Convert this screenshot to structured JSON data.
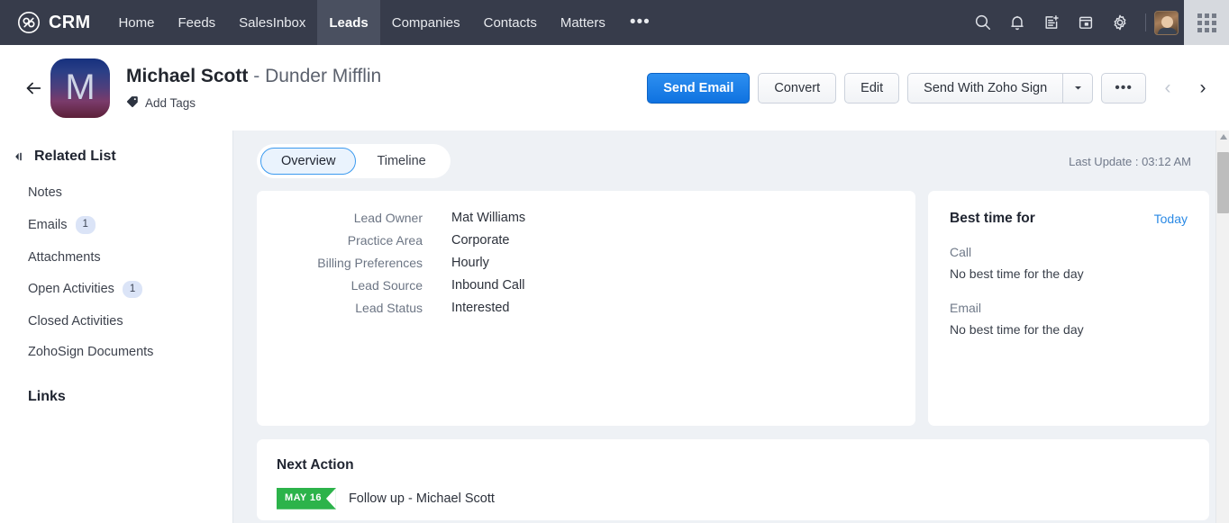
{
  "topnav": {
    "brand": "CRM",
    "brand_logo_icon": "infinity-logo-icon",
    "items": [
      {
        "label": "Home",
        "active": false
      },
      {
        "label": "Feeds",
        "active": false
      },
      {
        "label": "SalesInbox",
        "active": false
      },
      {
        "label": "Leads",
        "active": true
      },
      {
        "label": "Companies",
        "active": false
      },
      {
        "label": "Contacts",
        "active": false
      },
      {
        "label": "Matters",
        "active": false
      }
    ],
    "overflow_label": "•••",
    "icons": [
      "search-icon",
      "bell-icon",
      "add-note-icon",
      "calendar-icon",
      "gear-icon"
    ],
    "apps_icon": "apps-grid-icon",
    "avatar_icon": "user-avatar"
  },
  "record": {
    "back_icon": "back-arrow-icon",
    "avatar_initial": "M",
    "name": "Michael Scott",
    "separator": "-",
    "company": "Dunder Mifflin",
    "tag_icon": "tag-icon",
    "add_tags_label": "Add Tags",
    "actions": {
      "send_email": "Send Email",
      "convert": "Convert",
      "edit": "Edit",
      "zoho_sign": "Send With Zoho Sign",
      "split_caret_icon": "chevron-down-icon",
      "more_label": "•••",
      "prev_icon": "chevron-left-icon",
      "next_icon": "chevron-right-icon"
    }
  },
  "sidebar": {
    "collapse_icon": "collapse-panel-icon",
    "title": "Related List",
    "items": [
      {
        "label": "Notes",
        "badge": ""
      },
      {
        "label": "Emails",
        "badge": "1"
      },
      {
        "label": "Attachments",
        "badge": ""
      },
      {
        "label": "Open Activities",
        "badge": "1"
      },
      {
        "label": "Closed Activities",
        "badge": ""
      },
      {
        "label": "ZohoSign Documents",
        "badge": ""
      }
    ],
    "links_title": "Links"
  },
  "main": {
    "tabs": [
      {
        "label": "Overview",
        "active": true
      },
      {
        "label": "Timeline",
        "active": false
      }
    ],
    "last_update": "Last Update : 03:12 AM",
    "details": [
      {
        "label": "Lead Owner",
        "value": "Mat Williams"
      },
      {
        "label": "Practice Area",
        "value": "Corporate"
      },
      {
        "label": "Billing Preferences",
        "value": "Hourly"
      },
      {
        "label": "Lead Source",
        "value": "Inbound Call"
      },
      {
        "label": "Lead Status",
        "value": "Interested"
      }
    ],
    "best_time": {
      "title": "Best time for",
      "today_link": "Today",
      "entries": [
        {
          "label": "Call",
          "value": "No best time for the day"
        },
        {
          "label": "Email",
          "value": "No best time for the day"
        }
      ]
    },
    "next_action": {
      "title": "Next Action",
      "date_badge": "MAY 16",
      "text": "Follow up - Michael Scott"
    }
  },
  "colors": {
    "nav_bg": "#373c4b",
    "nav_active": "#4a5060",
    "primary_blue": "#0f72e0",
    "accent_link": "#2b8ae5",
    "badge_bg": "#dbe4f7",
    "ribbon_green": "#2cb34a",
    "content_bg": "#eef1f5"
  }
}
